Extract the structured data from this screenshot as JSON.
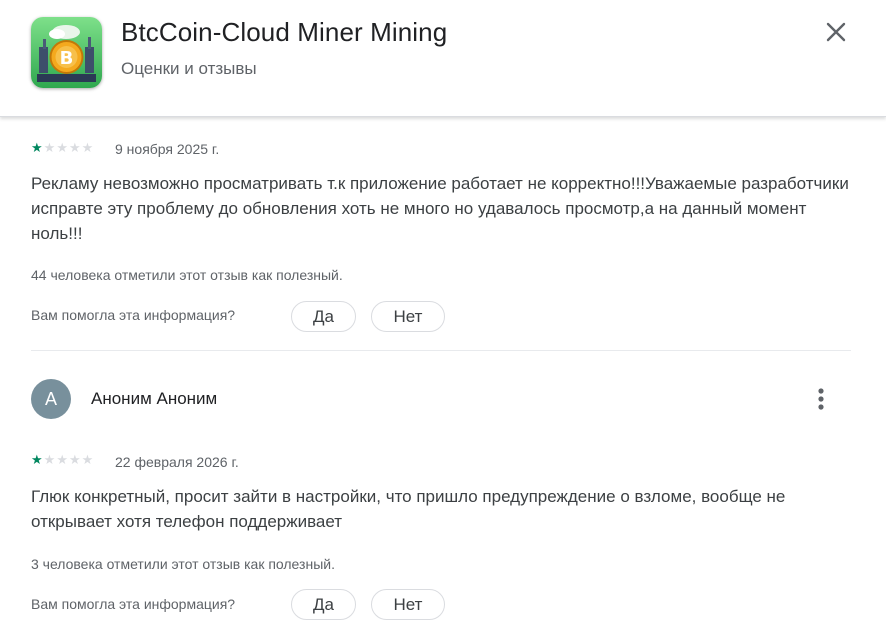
{
  "header": {
    "app_title": "BtcCoin-Cloud Miner Mining",
    "subtitle": "Оценки и отзывы"
  },
  "icons": {
    "close": "close-icon",
    "more": "more-vert-icon",
    "star": "star-icon",
    "app": "bitcoin-miner-app-icon"
  },
  "colors": {
    "star_filled": "#01875f",
    "star_empty": "#dadce0",
    "avatar_bg": "#78909c"
  },
  "reviews": [
    {
      "rating": 1,
      "date": "9 ноября 2025 г.",
      "text": "Рекламу невозможно просматривать т.к приложение работает не корректно!!!Уважаемые разработчики исправте эту проблему до обновления хоть не много но удавалось просмотр,а на данный момент ноль!!!",
      "helpful": "44 человека отметили этот отзыв как полезный.",
      "question": "Вам помогла эта информация?",
      "yes": "Да",
      "no": "Нет"
    },
    {
      "author": "Аноним Аноним",
      "avatar_letter": "А",
      "rating": 1,
      "date": "22 февраля 2026 г.",
      "text": "Глюк конкретный, просит зайти в настройки, что пришло предупреждение о взломе, вообще не открывает хотя телефон поддерживает",
      "helpful": "3 человека отметили этот отзыв как полезный.",
      "question": "Вам помогла эта информация?",
      "yes": "Да",
      "no": "Нет"
    }
  ]
}
